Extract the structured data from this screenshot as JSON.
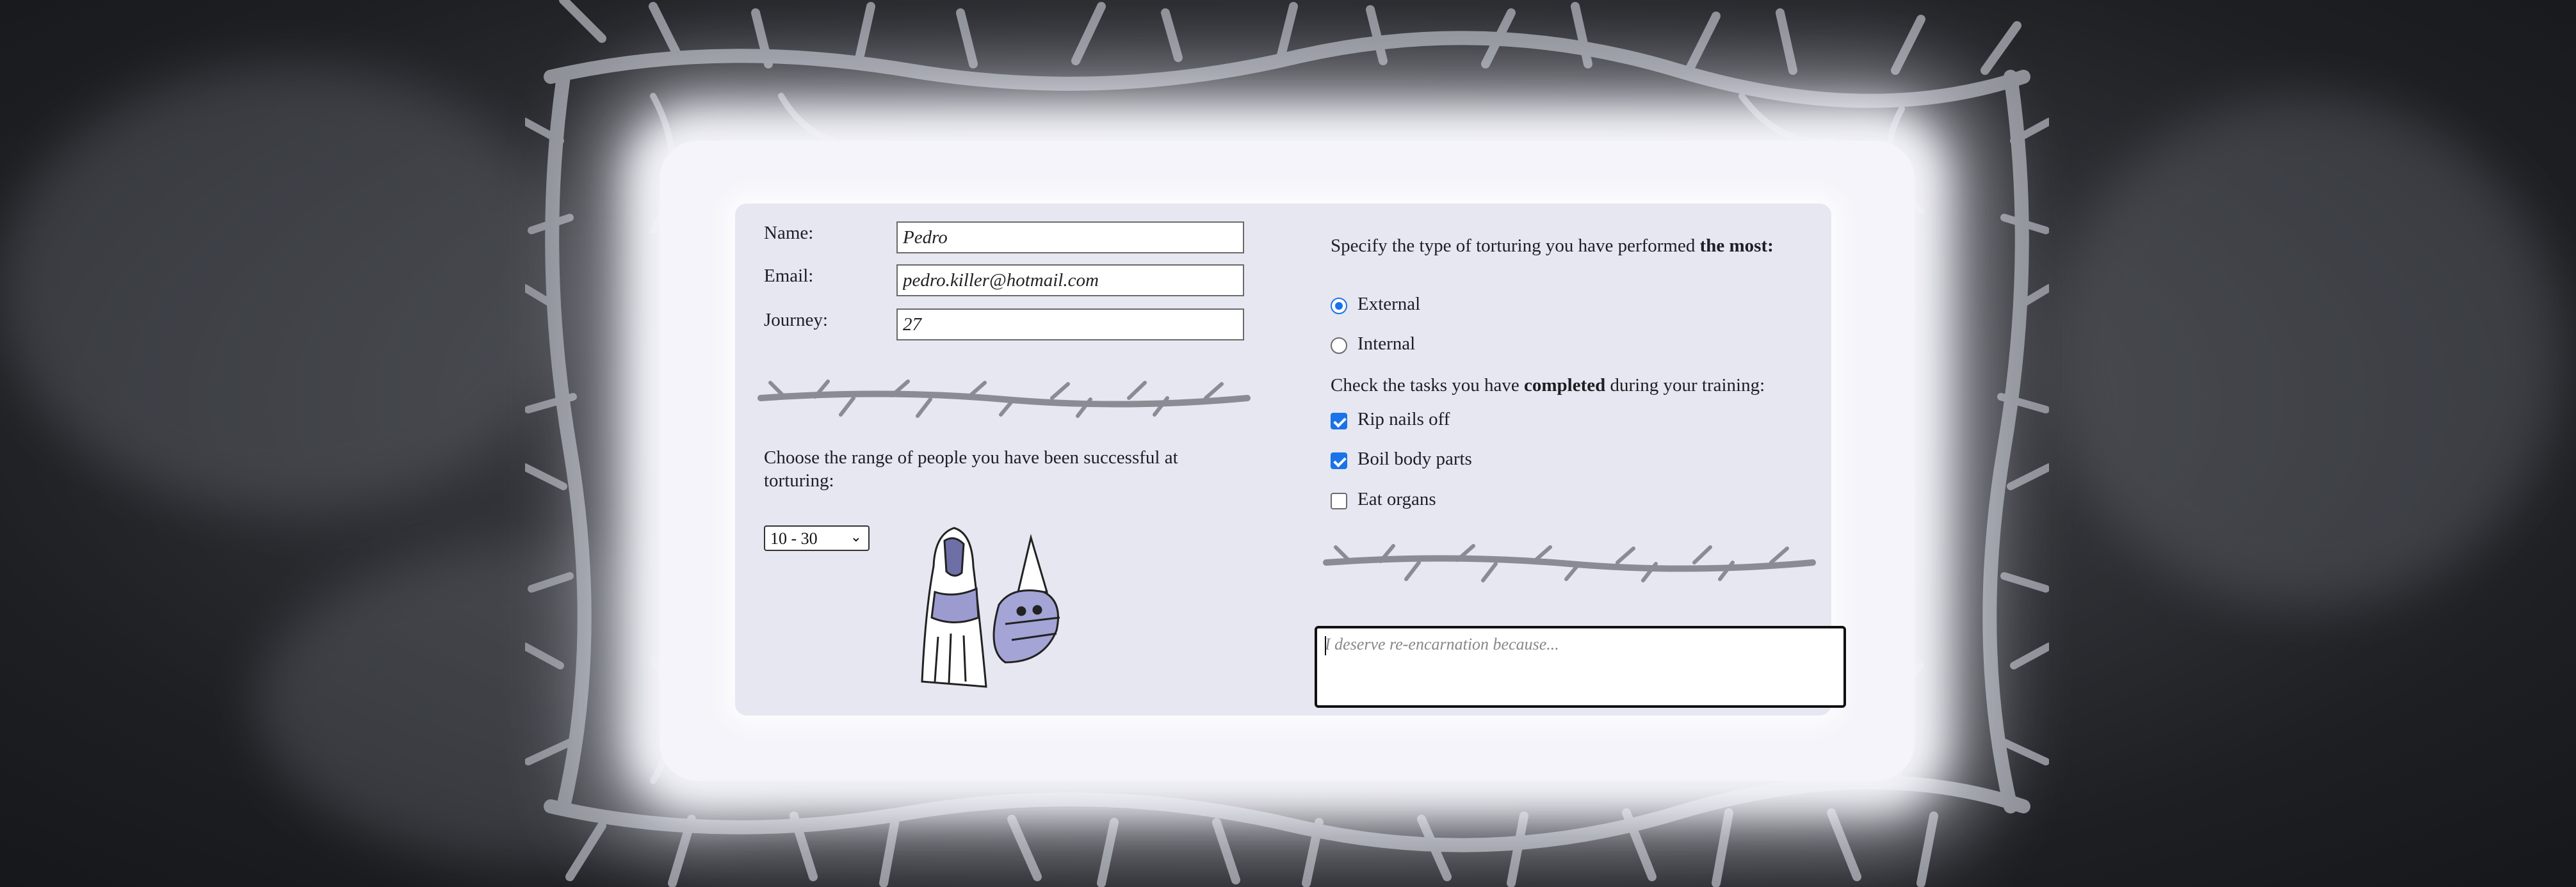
{
  "colors": {
    "accent": "#1a73e8",
    "card": "#f4f4fa",
    "panel": "#e6e7f0",
    "bg": "#1d1f23"
  },
  "form": {
    "name_label": "Name:",
    "name_value": "Pedro",
    "email_label": "Email:",
    "email_value": "pedro.killer@hotmail.com",
    "journey_label": "Journey:",
    "journey_value": "27",
    "range_prompt": "Choose the range of people you have been successful at torturing:",
    "range_selected": "10 - 30",
    "torture_prompt_start": "Specify the type of torturing you have performed ",
    "torture_prompt_bold": "the most",
    "torture_prompt_end": ":",
    "radio_external": "External",
    "radio_internal": "Internal",
    "radio_selected": "External",
    "tasks_prompt_start": "Check the tasks you have ",
    "tasks_prompt_bold": "completed",
    "tasks_prompt_end": " during your training:",
    "task_rip": "Rip nails off",
    "task_boil": "Boil body parts",
    "task_eat": "Eat organs",
    "task_rip_checked": true,
    "task_boil_checked": true,
    "task_eat_checked": false,
    "reason_placeholder": "I deserve re-encarnation because..."
  },
  "icons": [
    "thorny-branches-frame",
    "thorn-divider-icon",
    "hooded-figures-illustration",
    "chevron-down-icon"
  ]
}
